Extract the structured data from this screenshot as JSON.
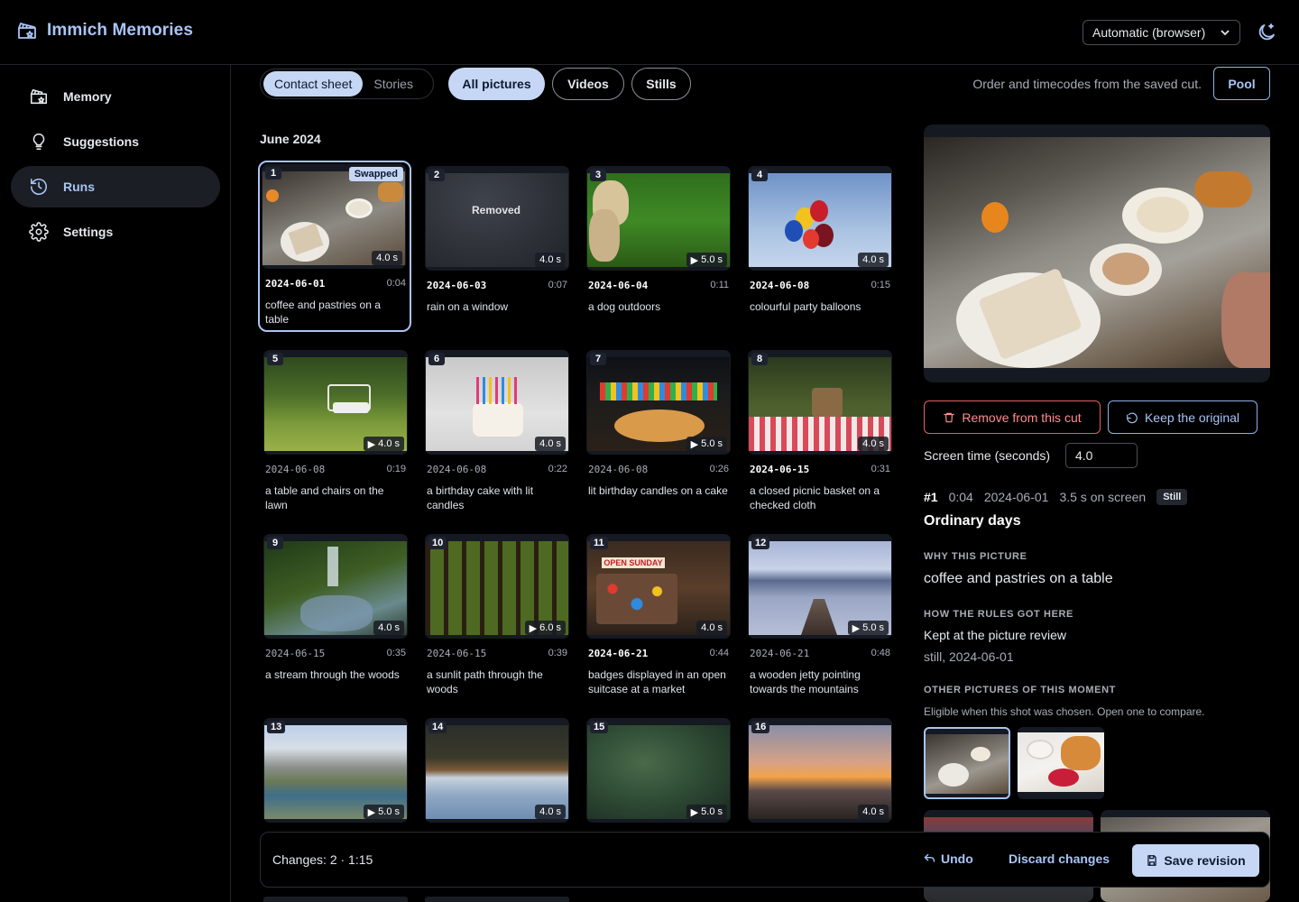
{
  "header": {
    "title": "Immich Memories",
    "theme_select": "Automatic (browser)"
  },
  "sidebar": {
    "items": [
      {
        "label": "Memory"
      },
      {
        "label": "Suggestions"
      },
      {
        "label": "Runs"
      },
      {
        "label": "Settings"
      }
    ]
  },
  "toolbar": {
    "view_tabs": [
      "Contact sheet",
      "Stories"
    ],
    "filters": [
      "All pictures",
      "Videos",
      "Stills"
    ],
    "order_note": "Order and timecodes from the saved cut.",
    "pool_label": "Pool"
  },
  "month_title": "June 2024",
  "cards": [
    {
      "num": "1",
      "dur": "4.0 s",
      "video": false,
      "date": "2024-06-01",
      "tc": "0:04",
      "caption": "coffee and pastries on a table",
      "badge": "Swapped"
    },
    {
      "num": "2",
      "dur": "4.0 s",
      "video": false,
      "date": "2024-06-03",
      "tc": "0:07",
      "caption": "rain on a window",
      "overlay": "Removed"
    },
    {
      "num": "3",
      "dur": "5.0 s",
      "video": true,
      "date": "2024-06-04",
      "tc": "0:11",
      "caption": "a dog outdoors"
    },
    {
      "num": "4",
      "dur": "4.0 s",
      "video": false,
      "date": "2024-06-08",
      "tc": "0:15",
      "caption": "colourful party balloons"
    },
    {
      "num": "5",
      "dur": "4.0 s",
      "video": true,
      "date": "2024-06-08",
      "tc": "0:19",
      "caption": "a table and chairs on the lawn"
    },
    {
      "num": "6",
      "dur": "4.0 s",
      "video": false,
      "date": "2024-06-08",
      "tc": "0:22",
      "caption": "a birthday cake with lit candles"
    },
    {
      "num": "7",
      "dur": "5.0 s",
      "video": true,
      "date": "2024-06-08",
      "tc": "0:26",
      "caption": "lit birthday candles on a cake"
    },
    {
      "num": "8",
      "dur": "4.0 s",
      "video": false,
      "date": "2024-06-15",
      "tc": "0:31",
      "caption": "a closed picnic basket on a checked cloth"
    },
    {
      "num": "9",
      "dur": "4.0 s",
      "video": false,
      "date": "2024-06-15",
      "tc": "0:35",
      "caption": "a stream through the woods"
    },
    {
      "num": "10",
      "dur": "6.0 s",
      "video": true,
      "date": "2024-06-15",
      "tc": "0:39",
      "caption": "a sunlit path through the woods"
    },
    {
      "num": "11",
      "dur": "4.0 s",
      "video": false,
      "date": "2024-06-21",
      "tc": "0:44",
      "caption": "badges displayed in an open suitcase at a market",
      "sign": "OPEN SUNDAY"
    },
    {
      "num": "12",
      "dur": "5.0 s",
      "video": true,
      "date": "2024-06-21",
      "tc": "0:48",
      "caption": "a wooden jetty pointing towards the mountains"
    },
    {
      "num": "13",
      "dur": "5.0 s",
      "video": true
    },
    {
      "num": "14",
      "dur": "4.0 s",
      "video": false
    },
    {
      "num": "15",
      "dur": "5.0 s",
      "video": true
    },
    {
      "num": "16",
      "dur": "4.0 s",
      "video": false
    }
  ],
  "detail": {
    "remove_label": "Remove from this cut",
    "keep_label": "Keep the original",
    "screen_time_label": "Screen time (seconds)",
    "screen_time_value": "4.0",
    "index": "#1",
    "timecode": "0:04",
    "date": "2024-06-01",
    "on_screen": "3.5 s on screen",
    "kind_badge": "Still",
    "moment_title": "Ordinary days",
    "why_label": "WHY THIS PICTURE",
    "why_text": "coffee and pastries on a table",
    "how_label": "HOW THE RULES GOT HERE",
    "how_text": "Kept at the picture review",
    "how_sub": "still, 2024-06-01",
    "other_label": "OTHER PICTURES OF THIS MOMENT",
    "other_sub": "Eligible when this shot was chosen. Open one to compare."
  },
  "bottom_bar": {
    "changes": "Changes: 2 · 1:15",
    "undo_label": "Undo",
    "discard_label": "Discard changes",
    "save_label": "Save revision"
  },
  "colors": {
    "accent": "#a9c4f5",
    "accent_fill": "#c6d7f6",
    "danger": "#ff8d8d",
    "background": "#000000"
  }
}
